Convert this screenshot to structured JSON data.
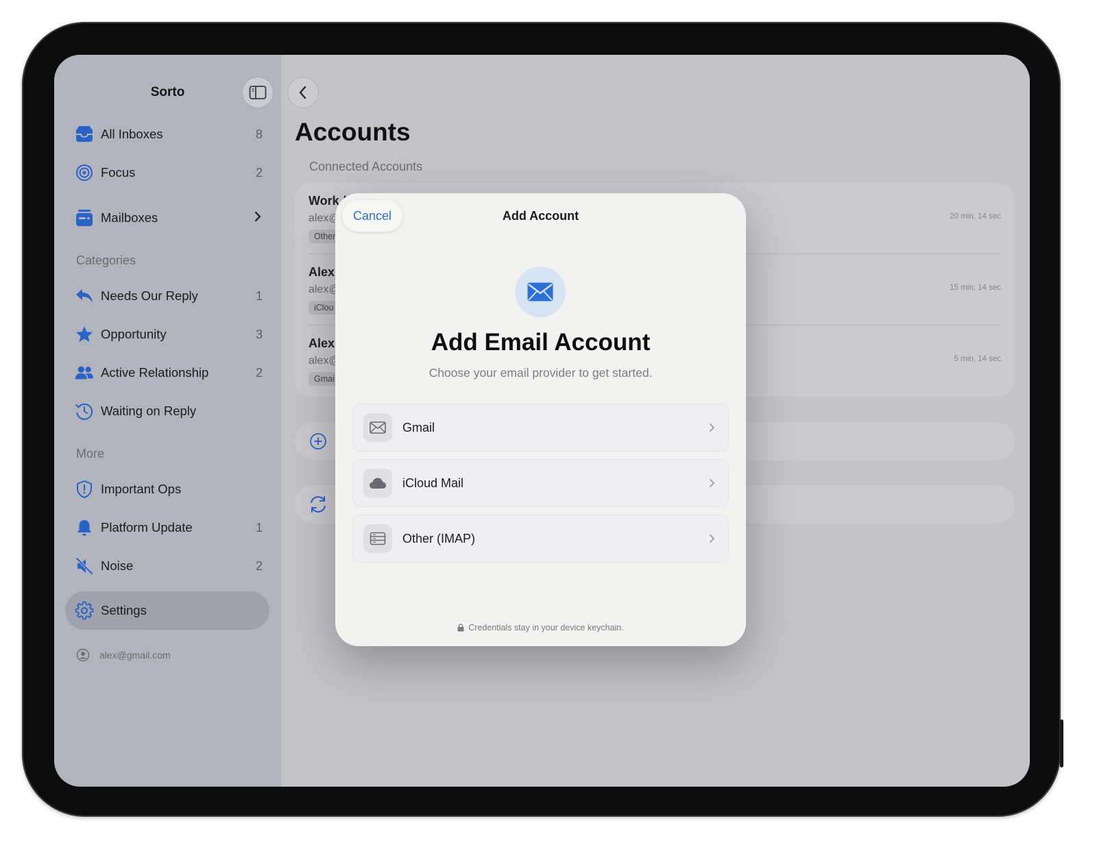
{
  "sidebar": {
    "title": "Sorto",
    "items": [
      {
        "label": "All Inboxes",
        "count": "8",
        "icon": "tray-icon"
      },
      {
        "label": "Focus",
        "count": "2",
        "icon": "target-icon"
      },
      {
        "label": "Mailboxes",
        "icon": "mailbox-icon"
      }
    ],
    "categories_header": "Categories",
    "categories": [
      {
        "label": "Needs Our Reply",
        "count": "1",
        "icon": "reply-icon"
      },
      {
        "label": "Opportunity",
        "count": "3",
        "icon": "star-icon"
      },
      {
        "label": "Active Relationship",
        "count": "2",
        "icon": "people-icon"
      },
      {
        "label": "Waiting on Reply",
        "icon": "clock-history-icon"
      }
    ],
    "more_header": "More",
    "more": [
      {
        "label": "Important Ops",
        "icon": "shield-alert-icon"
      },
      {
        "label": "Platform Update",
        "count": "1",
        "icon": "bell-icon"
      },
      {
        "label": "Noise",
        "count": "2",
        "icon": "mute-icon"
      }
    ],
    "settings_label": "Settings",
    "account_email": "alex@gmail.com"
  },
  "main": {
    "title": "Accounts",
    "section_header": "Connected Accounts",
    "accounts": [
      {
        "name": "Work /",
        "email": "alex@",
        "tag": "Other",
        "time": "20 min, 14 sec"
      },
      {
        "name": "Alex",
        "email": "alex@",
        "tag": "iClou",
        "time": "15 min, 14 sec"
      },
      {
        "name": "Alex",
        "email": "alex@",
        "tag": "Gmai",
        "time": "5 min, 14 sec"
      }
    ]
  },
  "modal": {
    "cancel_label": "Cancel",
    "title": "Add Account",
    "heading": "Add Email Account",
    "subtitle": "Choose your email provider to get started.",
    "options": [
      {
        "label": "Gmail",
        "icon": "envelope-icon"
      },
      {
        "label": "iCloud Mail",
        "icon": "cloud-icon"
      },
      {
        "label": "Other (IMAP)",
        "icon": "server-icon"
      }
    ],
    "footer": "Credentials stay in your device keychain."
  },
  "colors": {
    "accent_blue": "#2b6fd7",
    "sidebar_icon_blue": "#2a63c8"
  }
}
